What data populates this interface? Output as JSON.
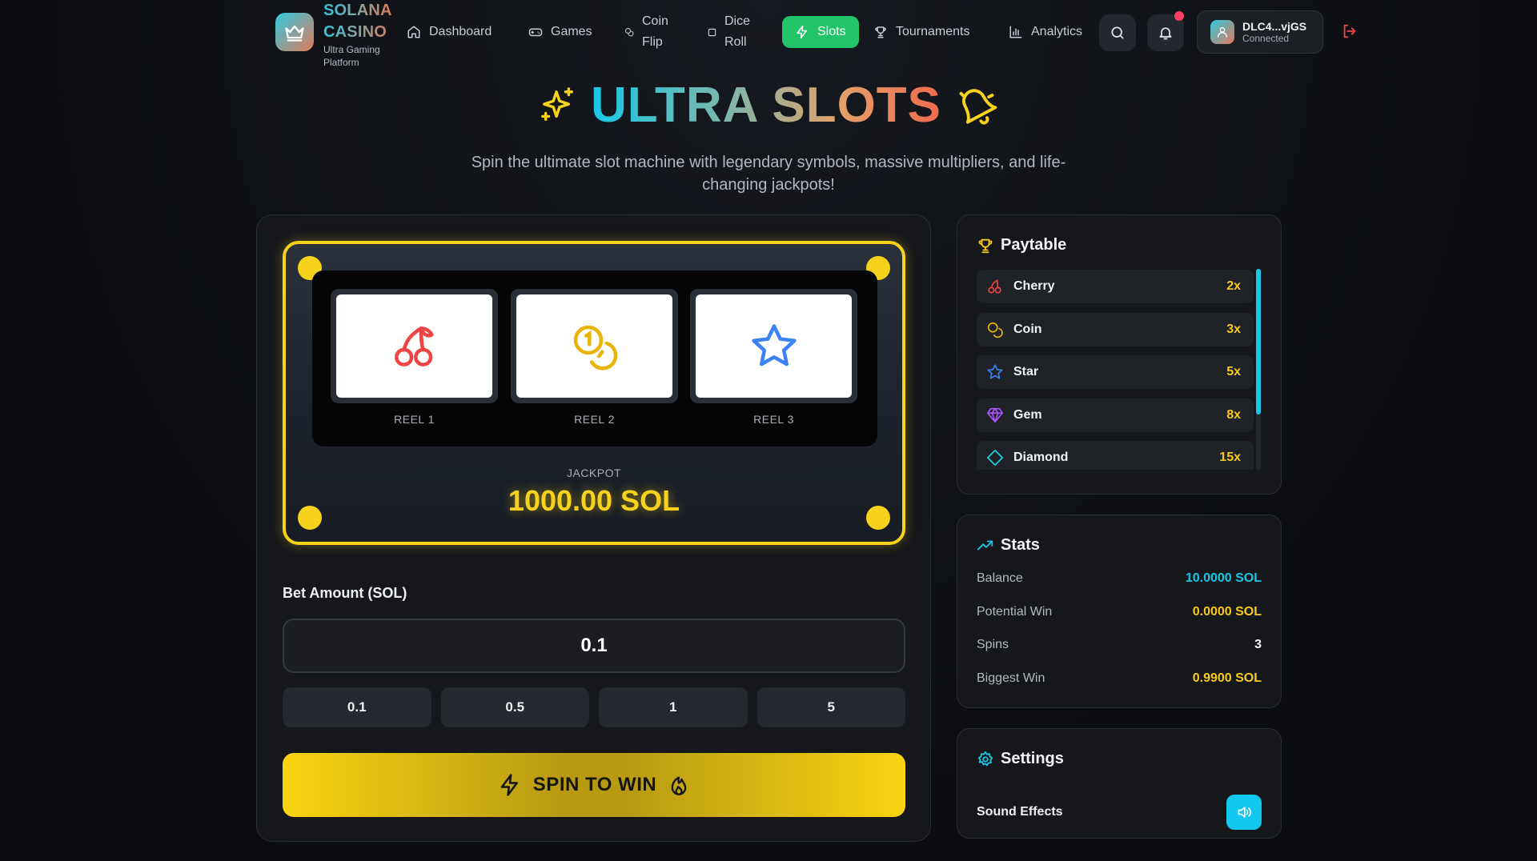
{
  "brand": {
    "line1": "SOLANA",
    "line2": "CASINO",
    "sub1": "Ultra Gaming",
    "sub2": "Platform"
  },
  "nav": {
    "dashboard": "Dashboard",
    "games": "Games",
    "coinflip_1": "Coin",
    "coinflip_2": "Flip",
    "diceroll_1": "Dice",
    "diceroll_2": "Roll",
    "slots": "Slots",
    "tournaments": "Tournaments",
    "analytics": "Analytics"
  },
  "wallet": {
    "address": "DLC4...vjGS",
    "status": "Connected"
  },
  "hero": {
    "title": "ULTRA SLOTS",
    "subtitle": "Spin the ultimate slot machine with legendary symbols, massive multipliers, and life-changing jackpots!"
  },
  "machine": {
    "reels": [
      {
        "label": "REEL 1",
        "symbol": "cherry-icon"
      },
      {
        "label": "REEL 2",
        "symbol": "coin-icon"
      },
      {
        "label": "REEL 3",
        "symbol": "star-icon"
      }
    ],
    "jackpot_label": "JACKPOT",
    "jackpot_value": "1000.00 SOL"
  },
  "bet": {
    "label": "Bet Amount (SOL)",
    "value": "0.1",
    "quick": [
      "0.1",
      "0.5",
      "1",
      "5"
    ],
    "spin_label": "SPIN TO WIN"
  },
  "paytable": {
    "title": "Paytable",
    "rows": [
      {
        "name": "Cherry",
        "mult": "2x",
        "icon": "cherry-icon"
      },
      {
        "name": "Coin",
        "mult": "3x",
        "icon": "coin-icon"
      },
      {
        "name": "Star",
        "mult": "5x",
        "icon": "star-icon"
      },
      {
        "name": "Gem",
        "mult": "8x",
        "icon": "gem-icon"
      },
      {
        "name": "Diamond",
        "mult": "15x",
        "icon": "diamond-icon"
      }
    ]
  },
  "stats": {
    "title": "Stats",
    "balance_label": "Balance",
    "balance": "10.0000 SOL",
    "potential_label": "Potential Win",
    "potential": "0.0000 SOL",
    "spins_label": "Spins",
    "spins": "3",
    "biggest_label": "Biggest Win",
    "biggest": "0.9900 SOL"
  },
  "settings": {
    "title": "Settings",
    "sound_label": "Sound Effects"
  },
  "colors": {
    "accent_yellow": "#f7d21c",
    "accent_cyan": "#16c8e6",
    "active_green": "#21c468",
    "notification_red": "#f43f5e"
  }
}
